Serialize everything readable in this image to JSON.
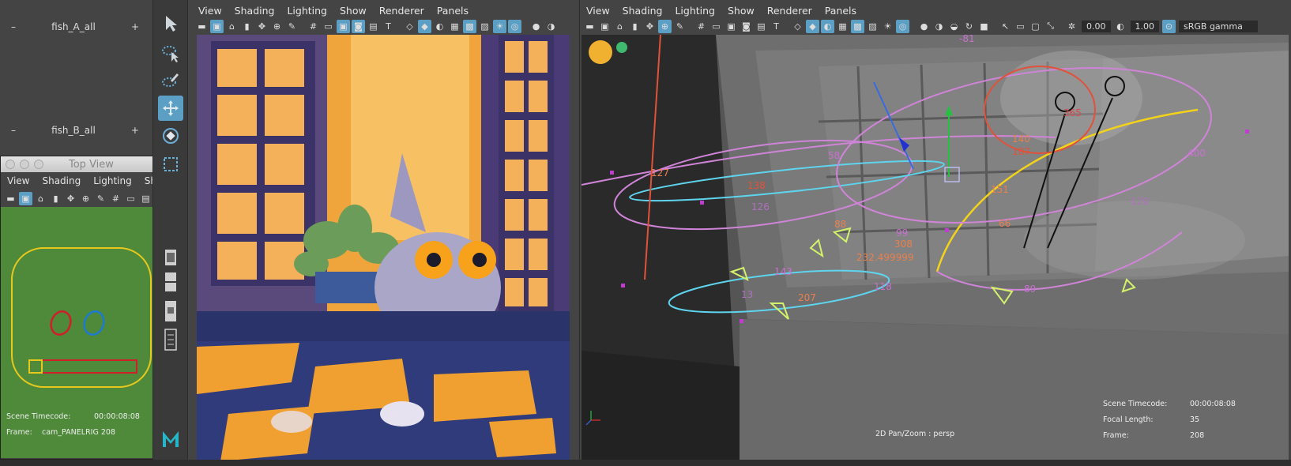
{
  "outliner": {
    "rows": [
      {
        "label": "fish_A_all",
        "minus": "–",
        "plus": "+"
      },
      {
        "label": "fish_B_all",
        "minus": "–",
        "plus": "+"
      }
    ]
  },
  "top_view": {
    "title": "Top View",
    "menu": [
      "View",
      "Shading",
      "Lighting",
      "Show"
    ],
    "more": "»",
    "hud": {
      "timecode_label": "Scene Timecode:",
      "timecode_value": "00:00:08:08",
      "frame_label": "Frame:",
      "frame_value": "cam_PANELRIG 208"
    },
    "colors": {
      "bg": "#4e8a3a",
      "outline": "#e8c81c"
    }
  },
  "viewport_center": {
    "menu": [
      "View",
      "Shading",
      "Lighting",
      "Show",
      "Renderer",
      "Panels"
    ]
  },
  "viewport_right": {
    "menu": [
      "View",
      "Shading",
      "Lighting",
      "Show",
      "Renderer",
      "Panels"
    ],
    "exposure": "0.00",
    "gamma": "1.00",
    "colorspace": "sRGB gamma",
    "hud": {
      "timecode_label": "Scene Timecode:",
      "timecode_value": "00:00:08:08",
      "focal_label": "Focal Length:",
      "focal_value": "35",
      "frame_label": "Frame:",
      "frame_value": "208",
      "pan_zoom": "2D Pan/Zoom : persp"
    },
    "labels": [
      "-81",
      "127",
      "138",
      "126",
      "58",
      "140",
      "187",
      "365",
      "400",
      "-120",
      "151",
      "88",
      "99",
      "308",
      "232.499999",
      "143",
      "13",
      "207",
      "118",
      "89",
      "66"
    ]
  },
  "accent": "#5b9fc4"
}
